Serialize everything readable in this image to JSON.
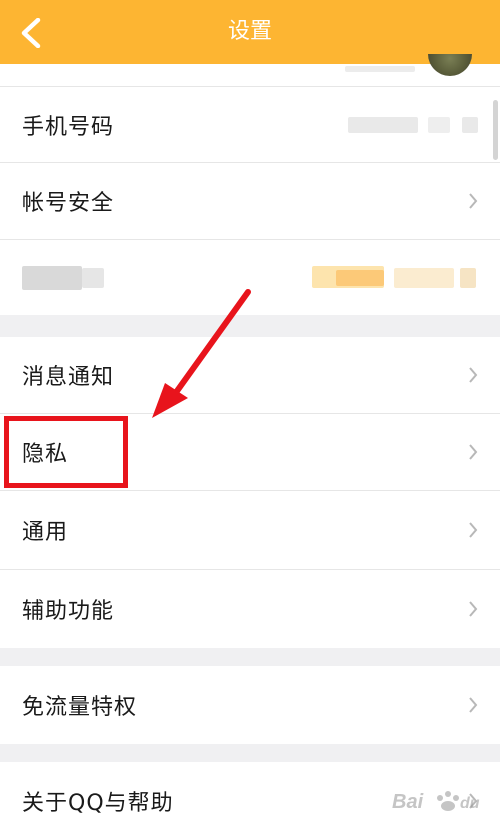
{
  "header": {
    "title": "设置",
    "background": "#fdb532"
  },
  "rows": {
    "phone": {
      "label": "手机号码"
    },
    "account_security": {
      "label": "帐号安全"
    },
    "notifications": {
      "label": "消息通知"
    },
    "privacy": {
      "label": "隐私"
    },
    "general": {
      "label": "通用"
    },
    "accessibility": {
      "label": "辅助功能"
    },
    "data_free": {
      "label": "免流量特权"
    },
    "about_help": {
      "label": "关于QQ与帮助"
    }
  },
  "annotation": {
    "highlight_color": "#e8141c",
    "arrow_color": "#e8141c"
  },
  "watermark": {
    "text": "Bai du 经验"
  }
}
